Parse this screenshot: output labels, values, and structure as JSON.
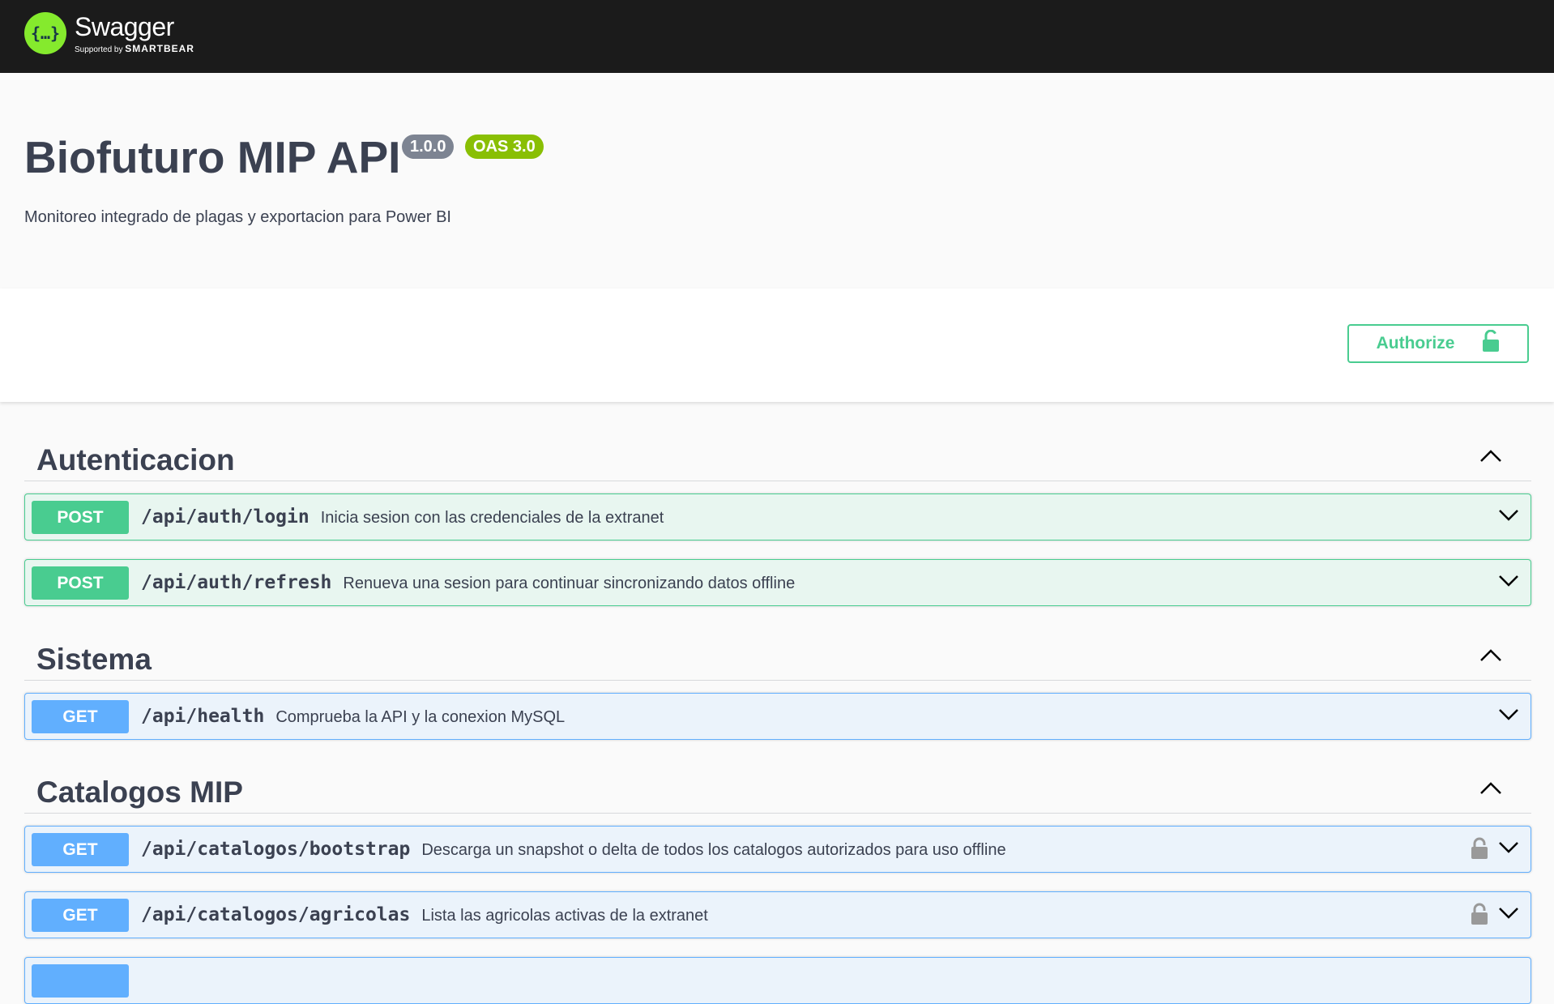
{
  "topbar": {
    "logo_symbol": "{…}",
    "logo_name": "Swagger",
    "logo_sub_prefix": "Supported by",
    "logo_sub_brand": "SMARTBEAR"
  },
  "info": {
    "title": "Biofuturo MIP API",
    "version": "1.0.0",
    "oas": "OAS 3.0",
    "description": "Monitoreo integrado de plagas y exportacion para Power BI"
  },
  "scheme": {
    "authorize_label": "Authorize",
    "authorize_icon": "unlock-icon"
  },
  "colors": {
    "topbar": "#1b1b1b",
    "post": "#49cc90",
    "get": "#61affe",
    "version_badge": "#7d8492",
    "oas_badge": "#89bf04"
  },
  "sections": [
    {
      "title": "Autenticacion",
      "operations": [
        {
          "method": "POST",
          "path": "/api/auth/login",
          "summary": "Inicia sesion con las credenciales de la extranet",
          "locked": false
        },
        {
          "method": "POST",
          "path": "/api/auth/refresh",
          "summary": "Renueva una sesion para continuar sincronizando datos offline",
          "locked": false
        }
      ]
    },
    {
      "title": "Sistema",
      "operations": [
        {
          "method": "GET",
          "path": "/api/health",
          "summary": "Comprueba la API y la conexion MySQL",
          "locked": false
        }
      ]
    },
    {
      "title": "Catalogos MIP",
      "operations": [
        {
          "method": "GET",
          "path": "/api/catalogos/bootstrap",
          "summary": "Descarga un snapshot o delta de todos los catalogos autorizados para uso offline",
          "locked": true
        },
        {
          "method": "GET",
          "path": "/api/catalogos/agricolas",
          "summary": "Lista las agricolas activas de la extranet",
          "locked": true
        }
      ]
    }
  ]
}
